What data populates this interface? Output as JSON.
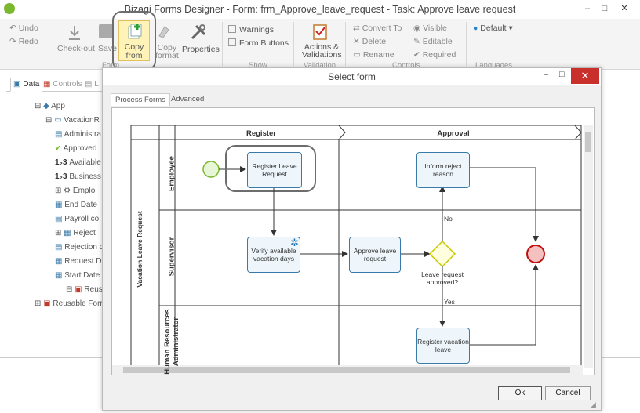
{
  "window": {
    "title": "Bizagi Forms Designer  - Form: frm_Approve_leave_request - Task:  Approve leave request",
    "min": "–",
    "max": "□",
    "close": "✕"
  },
  "ribbon": {
    "undo": "Undo",
    "redo": "Redo",
    "checkout": "Check-out",
    "save": "Save",
    "copy_from_line1": "Copy",
    "copy_from_line2": "from",
    "copy_format_line1": "Copy",
    "copy_format_line2": "format",
    "properties": "Properties",
    "group_form": "Form",
    "warnings": "Warnings",
    "form_buttons": "Form Buttons",
    "group_show": "Show",
    "actions_line1": "Actions &",
    "actions_line2": "Validations",
    "group_validation": "Validation",
    "convert_to": "Convert To",
    "delete": "Delete",
    "rename": "Rename",
    "visible": "Visible",
    "editable": "Editable",
    "required": "Required",
    "group_controls": "Controls",
    "language": "Default",
    "group_languages": "Languages"
  },
  "leftpanel": {
    "tabs": [
      "Data",
      "Controls",
      "L"
    ],
    "tree": [
      "App",
      "VacationR",
      "Administra",
      "Approved",
      "Available d",
      "Business d",
      "Emplo",
      "End Date",
      "Payroll co",
      "Reject",
      "Rejection d",
      "Request Da",
      "Start Date",
      "Reusal",
      "Reusable Forr"
    ]
  },
  "dialog": {
    "title": "Select form",
    "tabs": [
      "Process Forms",
      "Advanced"
    ],
    "ok": "Ok",
    "cancel": "Cancel",
    "min": "–",
    "max": "□",
    "close": "✕"
  },
  "diagram": {
    "pool": "Vacation Leave Request",
    "phases": [
      "Register",
      "Approval"
    ],
    "lanes": [
      "Employee",
      "Supervisor",
      "Human Resources Administrator"
    ],
    "tasks": {
      "register": "Register Leave Request",
      "verify": "Verify available vacation days",
      "approve": "Approve leave request",
      "inform": "Inform reject reason",
      "register_vac": "Register vacation leave"
    },
    "gateway_label": "Leave request approved?",
    "no": "No",
    "yes": "Yes"
  }
}
